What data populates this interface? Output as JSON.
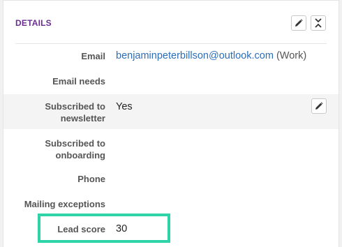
{
  "panel": {
    "title": "DETAILS",
    "edit_icon": "pencil-icon",
    "collapse_icon": "collapse-icon"
  },
  "fields": {
    "email": {
      "label": "Email",
      "value": "benjaminpeterbillson@outlook.com",
      "tag": "(Work)"
    },
    "email_needs": {
      "label": "Email needs",
      "value": ""
    },
    "newsletter": {
      "label_line1": "Subscribed to",
      "label_line2": "newsletter",
      "value": "Yes"
    },
    "onboarding": {
      "label_line1": "Subscribed to",
      "label_line2": "onboarding",
      "value": ""
    },
    "phone": {
      "label": "Phone",
      "value": ""
    },
    "mailing_exceptions": {
      "label": "Mailing exceptions",
      "value": ""
    },
    "lead_score": {
      "label": "Lead score",
      "value": "30"
    }
  },
  "colors": {
    "title": "#6a2c91",
    "link": "#2a6ebb",
    "highlight_box": "#2ed3a8"
  }
}
